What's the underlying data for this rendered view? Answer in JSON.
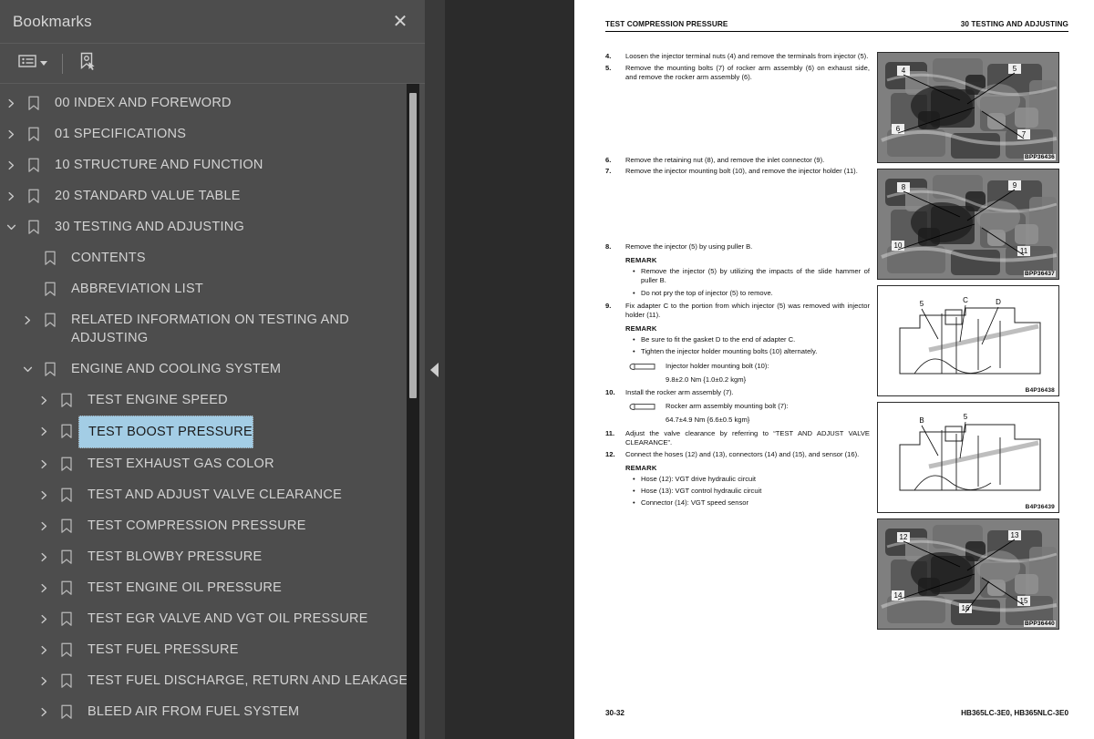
{
  "panel": {
    "title": "Bookmarks",
    "close_label": "✕",
    "toolbar": {
      "options_icon": "list-options-icon",
      "new_bookmark_icon": "new-bookmark-icon",
      "caret_icon": "chevron-down-icon"
    }
  },
  "splitter": {
    "collapse_icon": "collapse-panel-triangle-icon"
  },
  "tree": {
    "items": [
      {
        "label": "00 INDEX AND FOREWORD",
        "depth": 0,
        "twisty": "collapsed",
        "selected": false
      },
      {
        "label": "01 SPECIFICATIONS",
        "depth": 0,
        "twisty": "collapsed",
        "selected": false
      },
      {
        "label": "10 STRUCTURE AND FUNCTION",
        "depth": 0,
        "twisty": "collapsed",
        "selected": false
      },
      {
        "label": "20 STANDARD VALUE TABLE",
        "depth": 0,
        "twisty": "collapsed",
        "selected": false
      },
      {
        "label": "30 TESTING AND ADJUSTING",
        "depth": 0,
        "twisty": "expanded",
        "selected": false
      },
      {
        "label": "CONTENTS",
        "depth": 1,
        "twisty": "none",
        "selected": false
      },
      {
        "label": "ABBREVIATION LIST",
        "depth": 1,
        "twisty": "none",
        "selected": false
      },
      {
        "label": "RELATED INFORMATION ON TESTING AND ADJUSTING",
        "depth": 1,
        "twisty": "collapsed",
        "selected": false
      },
      {
        "label": "ENGINE AND COOLING SYSTEM",
        "depth": 1,
        "twisty": "expanded",
        "selected": false
      },
      {
        "label": "TEST ENGINE SPEED",
        "depth": 2,
        "twisty": "collapsed",
        "selected": false
      },
      {
        "label": "TEST BOOST PRESSURE",
        "depth": 2,
        "twisty": "collapsed",
        "selected": true
      },
      {
        "label": "TEST EXHAUST GAS COLOR",
        "depth": 2,
        "twisty": "collapsed",
        "selected": false
      },
      {
        "label": "TEST AND ADJUST VALVE CLEARANCE",
        "depth": 2,
        "twisty": "collapsed",
        "selected": false
      },
      {
        "label": "TEST COMPRESSION PRESSURE",
        "depth": 2,
        "twisty": "collapsed",
        "selected": false
      },
      {
        "label": "TEST BLOWBY PRESSURE",
        "depth": 2,
        "twisty": "collapsed",
        "selected": false
      },
      {
        "label": "TEST ENGINE OIL PRESSURE",
        "depth": 2,
        "twisty": "collapsed",
        "selected": false
      },
      {
        "label": "TEST EGR VALVE AND VGT OIL PRESSURE",
        "depth": 2,
        "twisty": "collapsed",
        "selected": false
      },
      {
        "label": "TEST FUEL PRESSURE",
        "depth": 2,
        "twisty": "collapsed",
        "selected": false
      },
      {
        "label": "TEST FUEL DISCHARGE, RETURN AND LEAKAGE",
        "depth": 2,
        "twisty": "collapsed",
        "selected": false
      },
      {
        "label": "BLEED AIR FROM FUEL SYSTEM",
        "depth": 2,
        "twisty": "collapsed",
        "selected": false
      }
    ]
  },
  "page": {
    "header_left": "TEST COMPRESSION PRESSURE",
    "header_right": "30 TESTING AND ADJUSTING",
    "footer_left": "30-32",
    "footer_right": "HB365LC-3E0, HB365NLC-3E0",
    "steps": [
      {
        "num": "4.",
        "text": "Loosen the injector terminal nuts (4) and remove the terminals from injector (5)."
      },
      {
        "num": "5.",
        "text": "Remove the mounting bolts (7) of rocker arm assembly (6) on exhaust side, and remove the rocker arm assembly (6)."
      },
      {
        "num": "6.",
        "text": "Remove the retaining nut (8), and remove the inlet connector (9)."
      },
      {
        "num": "7.",
        "text": "Remove the injector mounting bolt (10), and remove the injector holder (11)."
      },
      {
        "num": "8.",
        "text": "Remove the injector (5) by using puller B."
      },
      {
        "num": "9.",
        "text": "Fix adapter C to the portion from which injector (5) was removed with injector holder (11)."
      },
      {
        "num": "10.",
        "text": "Install the rocker arm assembly (7)."
      },
      {
        "num": "11.",
        "text": "Adjust the valve clearance by referring to “TEST AND ADJUST VALVE CLEARANCE”."
      },
      {
        "num": "12.",
        "text": "Connect the hoses (12) and (13), connectors (14) and (15), and sensor (16)."
      }
    ],
    "remark_label": "REMARK",
    "remarks_8": [
      "Remove the injector (5) by utilizing the impacts of the slide hammer of puller B.",
      "Do not pry the top of injector (5) to remove."
    ],
    "remarks_9": [
      "Be sure to fit the gasket D to the end of adapter C.",
      "Tighten the injector holder mounting bolts (10) alternately."
    ],
    "remarks_12": [
      "Hose (12): VGT drive hydraulic circuit",
      "Hose (13): VGT control hydraulic circuit",
      "Connector (14): VGT speed sensor"
    ],
    "torque_1": {
      "label": "Injector holder mounting bolt (10):",
      "value": "9.8±2.0 Nm {1.0±0.2 kgm}"
    },
    "torque_2": {
      "label": "Rocker arm assembly mounting bolt (7):",
      "value": "64.7±4.9 Nm {6.6±0.5 kgm}"
    },
    "figures": [
      {
        "caption": "BPP36436",
        "kind": "photo",
        "callouts": [
          "4",
          "5",
          "6",
          "7"
        ]
      },
      {
        "caption": "BPP36437",
        "kind": "photo",
        "callouts": [
          "8",
          "9",
          "10",
          "11"
        ]
      },
      {
        "caption": "B4P36438",
        "kind": "drawing",
        "callouts": [
          "5",
          "C",
          "D"
        ]
      },
      {
        "caption": "B4P36439",
        "kind": "drawing",
        "callouts": [
          "B",
          "5"
        ]
      },
      {
        "caption": "BPP36440",
        "kind": "photo",
        "callouts": [
          "12",
          "13",
          "14",
          "15",
          "16"
        ]
      }
    ]
  },
  "colors": {
    "panel_bg": "#4d4d4d",
    "viewer_bg": "#2b2b2b",
    "selection": "#a3cde5",
    "text": "#d3d3d3"
  }
}
